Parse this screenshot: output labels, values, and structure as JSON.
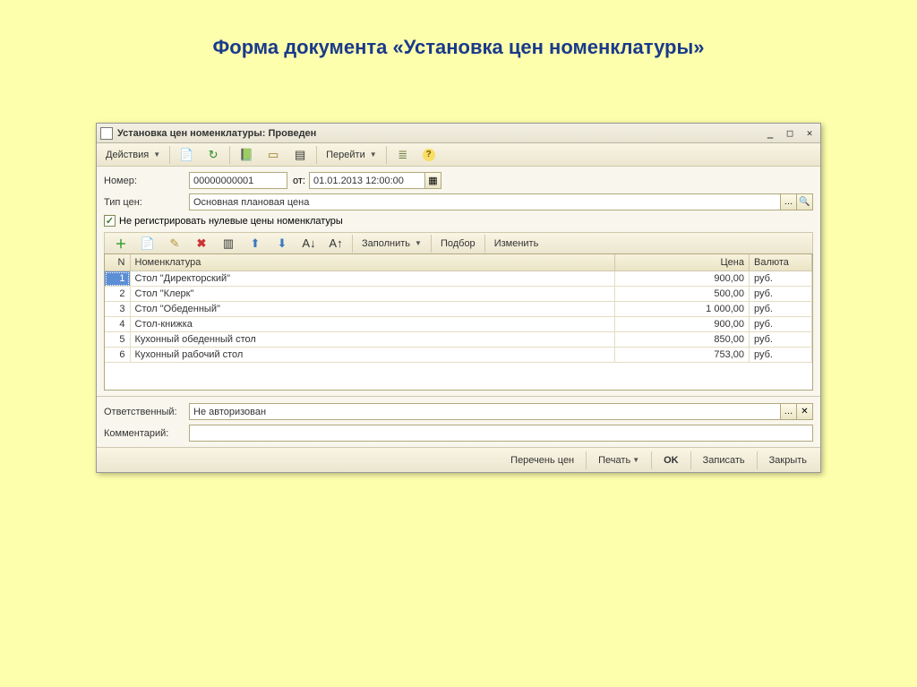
{
  "page_heading": "Форма документа «Установка цен номенклатуры»",
  "window": {
    "title": "Установка цен номенклатуры: Проведен"
  },
  "toolbar": {
    "actions": "Действия",
    "goto": "Перейти"
  },
  "form": {
    "number_label": "Номер:",
    "number_value": "00000000001",
    "date_label": "от:",
    "date_value": "01.01.2013 12:00:00",
    "pricetype_label": "Тип цен:",
    "pricetype_value": "Основная плановая цена",
    "checkbox_label": "Не регистрировать нулевые цены номенклатуры",
    "responsible_label": "Ответственный:",
    "responsible_value": "Не авторизован",
    "comment_label": "Комментарий:",
    "comment_value": ""
  },
  "grid_toolbar": {
    "fill": "Заполнить",
    "select": "Подбор",
    "change": "Изменить"
  },
  "grid": {
    "headers": {
      "n": "N",
      "name": "Номенклатура",
      "price": "Цена",
      "currency": "Валюта"
    },
    "rows": [
      {
        "n": "1",
        "name": "Стол \"Директорский\"",
        "price": "900,00",
        "currency": "руб."
      },
      {
        "n": "2",
        "name": "Стол \"Клерк\"",
        "price": "500,00",
        "currency": "руб."
      },
      {
        "n": "3",
        "name": "Стол \"Обеденный\"",
        "price": "1 000,00",
        "currency": "руб."
      },
      {
        "n": "4",
        "name": "Стол-книжка",
        "price": "900,00",
        "currency": "руб."
      },
      {
        "n": "5",
        "name": "Кухонный обеденный стол",
        "price": "850,00",
        "currency": "руб."
      },
      {
        "n": "6",
        "name": "Кухонный рабочий стол",
        "price": "753,00",
        "currency": "руб."
      }
    ]
  },
  "footer": {
    "pricelist": "Перечень цен",
    "print": "Печать",
    "ok": "OK",
    "save": "Записать",
    "close": "Закрыть"
  }
}
